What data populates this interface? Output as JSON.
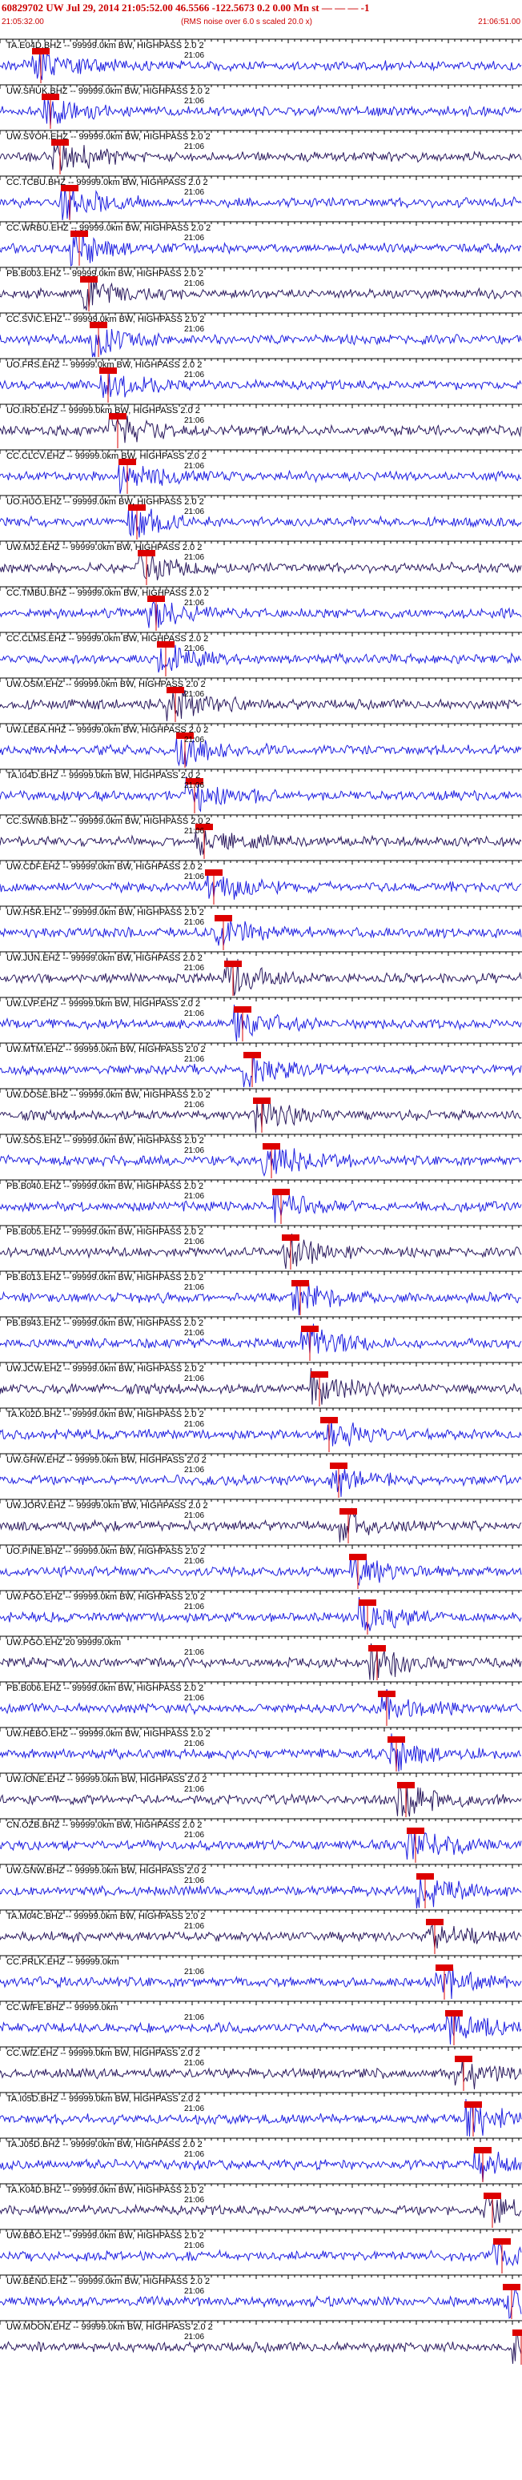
{
  "header": {
    "title": "60829702 UW Jul 29, 2014 21:05:52.00   46.5566 -122.5673  0.2 0.00 Mn st — — —  -1",
    "time_start": "21:05:32.00",
    "rms_note": "(RMS noise over 6.0 s scaled 20.0 x)",
    "time_end": "21:06:51.00"
  },
  "colors": {
    "header_text": "#cc0000",
    "trace_blue": "#1f1fe0",
    "trace_dark": "#2b1a5e",
    "pick_marker": "#dd0000"
  },
  "stations": [
    {
      "label": "TA.E04D.BHZ -- 99999.0km BW, HIGHPASS  2.0  2",
      "minute": "21:06"
    },
    {
      "label": "UW.SHUK.BHZ -- 99999.0km BW, HIGHPASS  2.0  2",
      "minute": "21:06"
    },
    {
      "label": "UW.SVOH.EHZ -- 99999.0km BW, HIGHPASS  2.0  2",
      "minute": "21:06"
    },
    {
      "label": "CC.TCBU.BHZ -- 99999.0km BW, HIGHPASS  2.0  2",
      "minute": "21:06"
    },
    {
      "label": "CC.WRBU.EHZ -- 99999.0km BW, HIGHPASS  2.0  2",
      "minute": "21:06"
    },
    {
      "label": "PB.B003.EHZ -- 99999.0km BW, HIGHPASS  2.0  2",
      "minute": "21:06"
    },
    {
      "label": "CC.SVIC.EHZ -- 99999.0km BW, HIGHPASS  2.0  2",
      "minute": "21:06"
    },
    {
      "label": "UO.FRS.EHZ -- 99999.0km BW, HIGHPASS  2.0  2",
      "minute": "21:06"
    },
    {
      "label": "UO.IRO.EHZ -- 99999.0km BW, HIGHPASS  2.0  2",
      "minute": "21:06"
    },
    {
      "label": "CC.CLCV.EHZ -- 99999.0km BW, HIGHPASS  2.0  2",
      "minute": "21:06"
    },
    {
      "label": "UO.HUO.EHZ -- 99999.0km BW, HIGHPASS  2.0  2",
      "minute": "21:06"
    },
    {
      "label": "UW.MJ2.EHZ -- 99999.0km BW, HIGHPASS  2.0  2",
      "minute": "21:06"
    },
    {
      "label": "CC.TMBU.BHZ -- 99999.0km BW, HIGHPASS  2.0  2",
      "minute": "21:06"
    },
    {
      "label": "CC.CLMS.EHZ -- 99999.0km BW, HIGHPASS  2.0  2",
      "minute": "21:06"
    },
    {
      "label": "UW.OSM.EHZ -- 99999.0km BW, HIGHPASS  2.0  2",
      "minute": "21:06"
    },
    {
      "label": "UW.LEBA.HHZ -- 99999.0km BW, HIGHPASS  2.0  2",
      "minute": "21:06"
    },
    {
      "label": "TA.I04D.BHZ -- 99999.0km BW, HIGHPASS  2.0  2",
      "minute": "21:06"
    },
    {
      "label": "CC.SWNB.BHZ -- 99999.0km BW, HIGHPASS  2.0  2",
      "minute": "21:06"
    },
    {
      "label": "UW.CDF.EHZ -- 99999.0km BW, HIGHPASS  2.0  2",
      "minute": "21:06"
    },
    {
      "label": "UW.HSR.EHZ -- 99999.0km BW, HIGHPASS  2.0  2",
      "minute": "21:06"
    },
    {
      "label": "UW.JUN.EHZ -- 99999.0km BW, HIGHPASS  2.0  2",
      "minute": "21:06"
    },
    {
      "label": "UW.LVP.EHZ -- 99999.0km BW, HIGHPASS  2.0  2",
      "minute": "21:06"
    },
    {
      "label": "UW.MTM.EHZ -- 99999.0km BW, HIGHPASS  2.0  2",
      "minute": "21:06"
    },
    {
      "label": "UW.DOSE.BHZ -- 99999.0km BW, HIGHPASS  2.0  2",
      "minute": "21:06"
    },
    {
      "label": "UW.SOS.EHZ -- 99999.0km BW, HIGHPASS  2.0  2",
      "minute": "21:06"
    },
    {
      "label": "PB.B040.EHZ -- 99999.0km BW, HIGHPASS  2.0  2",
      "minute": "21:06"
    },
    {
      "label": "PB.B005.EHZ -- 99999.0km BW, HIGHPASS  2.0  2",
      "minute": "21:06"
    },
    {
      "label": "PB.B013.EHZ -- 99999.0km BW, HIGHPASS  2.0  2",
      "minute": "21:06"
    },
    {
      "label": "PB.B943.EHZ -- 99999.0km BW, HIGHPASS  2.0  2",
      "minute": "21:06"
    },
    {
      "label": "UW.JCW.EHZ -- 99999.0km BW, HIGHPASS  2.0  2",
      "minute": "21:06"
    },
    {
      "label": "TA.K02D.BHZ -- 99999.0km BW, HIGHPASS  2.0  2",
      "minute": "21:06"
    },
    {
      "label": "UW.GHW.EHZ -- 99999.0km BW, HIGHPASS  2.0  2",
      "minute": "21:06"
    },
    {
      "label": "UW.JORV.EHZ -- 99999.0km BW, HIGHPASS  2.0  2",
      "minute": "21:06"
    },
    {
      "label": "UO.PINE.BHZ -- 99999.0km BW, HIGHPASS  2.0  2",
      "minute": "21:06"
    },
    {
      "label": "UW.PGO.EHZ -- 99999.0km BW, HIGHPASS  2.0  2",
      "minute": "21:06"
    },
    {
      "label": "UW.PGO.EHZ 20 99999.0km",
      "minute": "21:06"
    },
    {
      "label": "PB.B006.EHZ -- 99999.0km BW, HIGHPASS  2.0  2",
      "minute": "21:06"
    },
    {
      "label": "UW.HEBO.EHZ -- 99999.0km BW, HIGHPASS  2.0  2",
      "minute": "21:06"
    },
    {
      "label": "UW.IONE.EHZ -- 99999.0km BW, HIGHPASS  2.0  2",
      "minute": "21:06"
    },
    {
      "label": "CN.OZB.BHZ -- 99999.0km BW, HIGHPASS  2.0  2",
      "minute": "21:06"
    },
    {
      "label": "UW.GNW.BHZ -- 99999.0km BW, HIGHPASS  2.0  2",
      "minute": "21:06"
    },
    {
      "label": "TA.M04C.BHZ -- 99999.0km BW, HIGHPASS  2.0  2",
      "minute": "21:06"
    },
    {
      "label": "CC.PRLK.EHZ -- 99999.0km",
      "minute": "21:06"
    },
    {
      "label": "CC.WIFE.BHZ -- 99999.0km",
      "minute": "21:06"
    },
    {
      "label": "CC.WIZ.EHZ -- 99999.0km BW, HIGHPASS  2.0  2",
      "minute": "21:06"
    },
    {
      "label": "TA.I05D.BHZ -- 99999.0km BW, HIGHPASS  2.0  2",
      "minute": "21:06"
    },
    {
      "label": "TA.J05D.BHZ -- 99999.0km BW, HIGHPASS  2.0  2",
      "minute": "21:06"
    },
    {
      "label": "TA.K04D.BHZ -- 99999.0km BW, HIGHPASS  2.0  2",
      "minute": "21:06"
    },
    {
      "label": "UW.BBO.EHZ -- 99999.0km BW, HIGHPASS  2.0  2",
      "minute": "21:06"
    },
    {
      "label": "UW.BEND.EHZ -- 99999.0km BW, HIGHPASS  2.0  2",
      "minute": "21:06"
    },
    {
      "label": "UW.MOON.EHZ -- 99999.0km BW, HIGHPASS  2.0  2",
      "minute": "21:06"
    }
  ]
}
